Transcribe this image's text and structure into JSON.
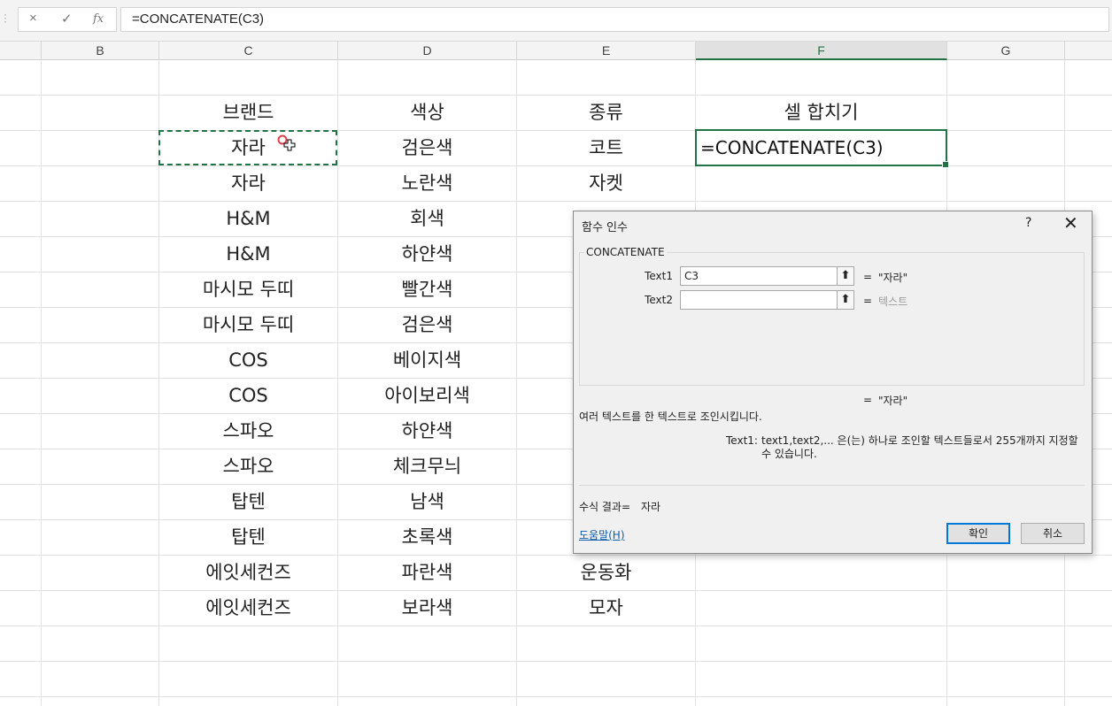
{
  "formula_bar": {
    "cancel_icon": "×",
    "enter_icon": "✓",
    "fx_icon": "fx",
    "formula": "=CONCATENATE(C3)"
  },
  "columns": [
    "B",
    "C",
    "D",
    "E",
    "F",
    "G"
  ],
  "selected_column": "F",
  "rows": [
    {
      "c": "브랜드",
      "d": "색상",
      "e": "종류",
      "f": "셀 합치기"
    },
    {
      "c": "자라",
      "d": "검은색",
      "e": "코트",
      "f": ""
    },
    {
      "c": "자라",
      "d": "노란색",
      "e": "자켓",
      "f": ""
    },
    {
      "c": "H&M",
      "d": "회색",
      "e": "",
      "f": ""
    },
    {
      "c": "H&M",
      "d": "하얀색",
      "e": "",
      "f": ""
    },
    {
      "c": "마시모 두띠",
      "d": "빨간색",
      "e": "",
      "f": ""
    },
    {
      "c": "마시모 두띠",
      "d": "검은색",
      "e": "",
      "f": ""
    },
    {
      "c": "COS",
      "d": "베이지색",
      "e": "",
      "f": ""
    },
    {
      "c": "COS",
      "d": "아이보리색",
      "e": "",
      "f": ""
    },
    {
      "c": "스파오",
      "d": "하얀색",
      "e": "",
      "f": ""
    },
    {
      "c": "스파오",
      "d": "체크무늬",
      "e": "",
      "f": ""
    },
    {
      "c": "탑텐",
      "d": "남색",
      "e": "",
      "f": ""
    },
    {
      "c": "탑텐",
      "d": "초록색",
      "e": "",
      "f": ""
    },
    {
      "c": "에잇세컨즈",
      "d": "파란색",
      "e": "운동화",
      "f": ""
    },
    {
      "c": "에잇세컨즈",
      "d": "보라색",
      "e": "모자",
      "f": ""
    }
  ],
  "active_cell_text": "=CONCATENATE(C3)",
  "dialog": {
    "title": "함수 인수",
    "help_icon": "?",
    "close_icon": "✕",
    "function_name": "CONCATENATE",
    "args": [
      {
        "label": "Text1",
        "value": "C3",
        "result": "\"자라\"",
        "muted": false
      },
      {
        "label": "Text2",
        "value": "",
        "result": "텍스트",
        "muted": true
      }
    ],
    "eq": "=",
    "overall_result": "\"자라\"",
    "description": "여러 텍스트를 한 텍스트로 조인시킵니다.",
    "arg_help_label": "Text1:",
    "arg_help_text": "text1,text2,... 은(는) 하나로 조인할 텍스트들로서 255개까지 지정할 수 있습니다.",
    "formula_result_label": "수식 결과=",
    "formula_result_value": "자라",
    "help_link": "도움말(H)",
    "ok_label": "확인",
    "cancel_label": "취소"
  },
  "colors": {
    "accent": "#217346",
    "dialog_primary": "#0078d7"
  }
}
